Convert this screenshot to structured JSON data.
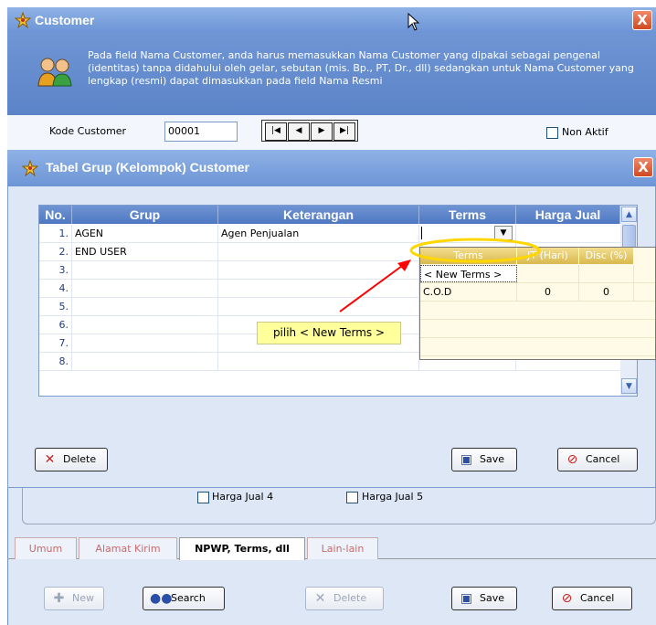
{
  "outer_window": {
    "title": "Customer",
    "close_label": "X",
    "header_message": "Pada field Nama Customer, anda harus memasukkan Nama Customer yang dipakai sebagai pengenal (identitas) tanpa didahului oleh gelar, sebutan (mis. Bp., PT, Dr., dll) sedangkan untuk Nama Customer yang lengkap (resmi) dapat dimasukkan pada field Nama Resmi",
    "kode_label": "Kode Customer",
    "kode_value": "00001",
    "nav_icons": [
      "first-record-icon",
      "prev-record-icon",
      "next-record-icon",
      "last-record-icon"
    ],
    "non_aktif_label": "Non Aktif",
    "harga_jual_4_label": "Harga Jual 4",
    "harga_jual_5_label": "Harga Jual 5",
    "tabs": [
      "Umum",
      "Alamat Kirim",
      "NPWP, Terms, dll",
      "Lain-lain"
    ],
    "active_tab": "NPWP, Terms, dll",
    "buttons": {
      "new": "New",
      "search": "Search",
      "delete": "Delete",
      "save": "Save",
      "cancel": "Cancel"
    }
  },
  "inner_window": {
    "title": "Tabel Grup (Kelompok) Customer",
    "close_label": "X",
    "columns": [
      "No.",
      "Grup",
      "Keterangan",
      "Terms",
      "Harga Jual"
    ],
    "rows": [
      {
        "no": "1.",
        "grup": "AGEN",
        "keterangan": "Agen Penjualan"
      },
      {
        "no": "2.",
        "grup": "END USER",
        "keterangan": ""
      },
      {
        "no": "3.",
        "grup": "",
        "keterangan": ""
      },
      {
        "no": "4.",
        "grup": "",
        "keterangan": ""
      },
      {
        "no": "5.",
        "grup": "",
        "keterangan": ""
      },
      {
        "no": "6.",
        "grup": "",
        "keterangan": ""
      },
      {
        "no": "7.",
        "grup": "",
        "keterangan": ""
      },
      {
        "no": "8.",
        "grup": "",
        "keterangan": ""
      }
    ],
    "buttons": {
      "delete": "Delete",
      "save": "Save",
      "cancel": "Cancel"
    }
  },
  "terms_dropdown": {
    "columns": [
      "Terms",
      "JT (Hari)",
      "Disc (%)"
    ],
    "rows": [
      {
        "terms": "< New Terms >",
        "jt": "",
        "disc": ""
      },
      {
        "terms": "C.O.D",
        "jt": "0",
        "disc": "0"
      }
    ]
  },
  "annotation": {
    "text": "pilih < New Terms >"
  },
  "colors": {
    "title_bar": "#7aa0df",
    "header_panel": "#6488cb",
    "grid_header": "#5f86c9",
    "dropdown_header": "#e8cc6a",
    "annotation_bg": "#ffff9c",
    "arrow": "#ff0000",
    "highlight_ellipse": "#ffd700"
  }
}
